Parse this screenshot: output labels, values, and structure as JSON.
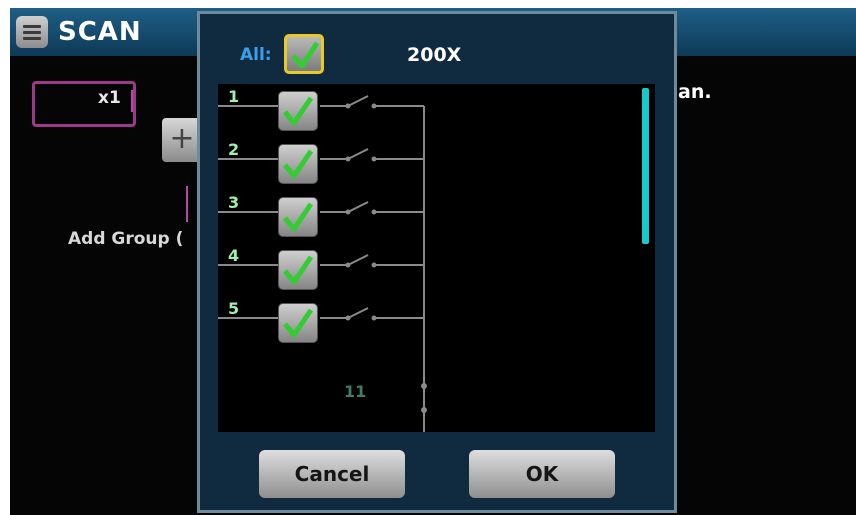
{
  "header": {
    "title": "SCAN",
    "menu_icon": "menu-icon"
  },
  "background": {
    "group_label": "x1",
    "add_group_text": "Add Group (",
    "right_text": "an.",
    "plus_label": "+"
  },
  "dialog": {
    "all_label": "All:",
    "all_checked": true,
    "title": "200X",
    "channels": [
      {
        "number": "1",
        "checked": true
      },
      {
        "number": "2",
        "checked": true
      },
      {
        "number": "3",
        "checked": true
      },
      {
        "number": "4",
        "checked": true
      },
      {
        "number": "5",
        "checked": true
      }
    ],
    "more_channel": "11",
    "cancel_label": "Cancel",
    "ok_label": "OK"
  },
  "colors": {
    "check_green": "#33cc33",
    "accent_cyan": "#19c8c8",
    "highlight_yellow": "#e8c928"
  }
}
